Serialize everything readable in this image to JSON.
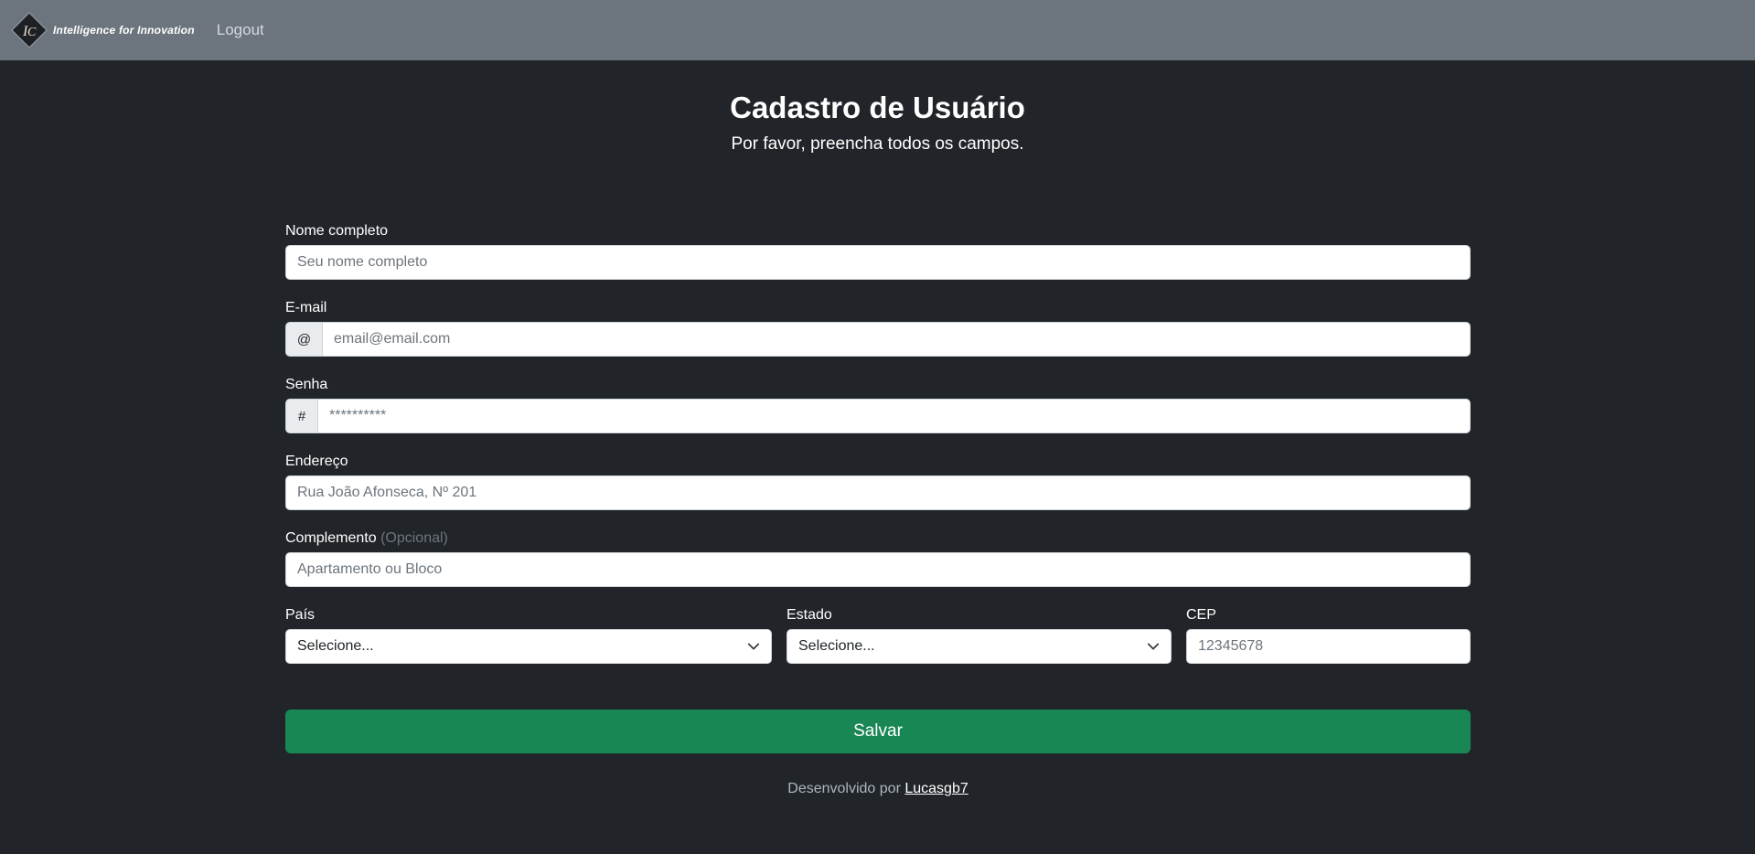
{
  "navbar": {
    "brand_text": "Intelligence for Innovation",
    "logo_icon": "diamond-logo-icon",
    "logout_label": "Logout"
  },
  "header": {
    "title": "Cadastro de Usuário",
    "subtitle": "Por favor, preencha todos os campos."
  },
  "form": {
    "name": {
      "label": "Nome completo",
      "placeholder": "Seu nome completo"
    },
    "email": {
      "label": "E-mail",
      "addon": "@",
      "placeholder": "email@email.com"
    },
    "password": {
      "label": "Senha",
      "addon": "#",
      "placeholder": "**********"
    },
    "address": {
      "label": "Endereço",
      "placeholder": "Rua João Afonseca, Nº 201"
    },
    "complement": {
      "label": "Complemento",
      "optional": "(Opcional)",
      "placeholder": "Apartamento ou Bloco"
    },
    "country": {
      "label": "País",
      "selected": "Selecione..."
    },
    "state": {
      "label": "Estado",
      "selected": "Selecione..."
    },
    "cep": {
      "label": "CEP",
      "placeholder": "12345678"
    },
    "save_label": "Salvar"
  },
  "footer": {
    "prefix": "Desenvolvido por",
    "author_link": "Lucasgb7"
  },
  "colors": {
    "background": "#212529",
    "navbar": "#6c757d",
    "save_button": "#198754"
  }
}
